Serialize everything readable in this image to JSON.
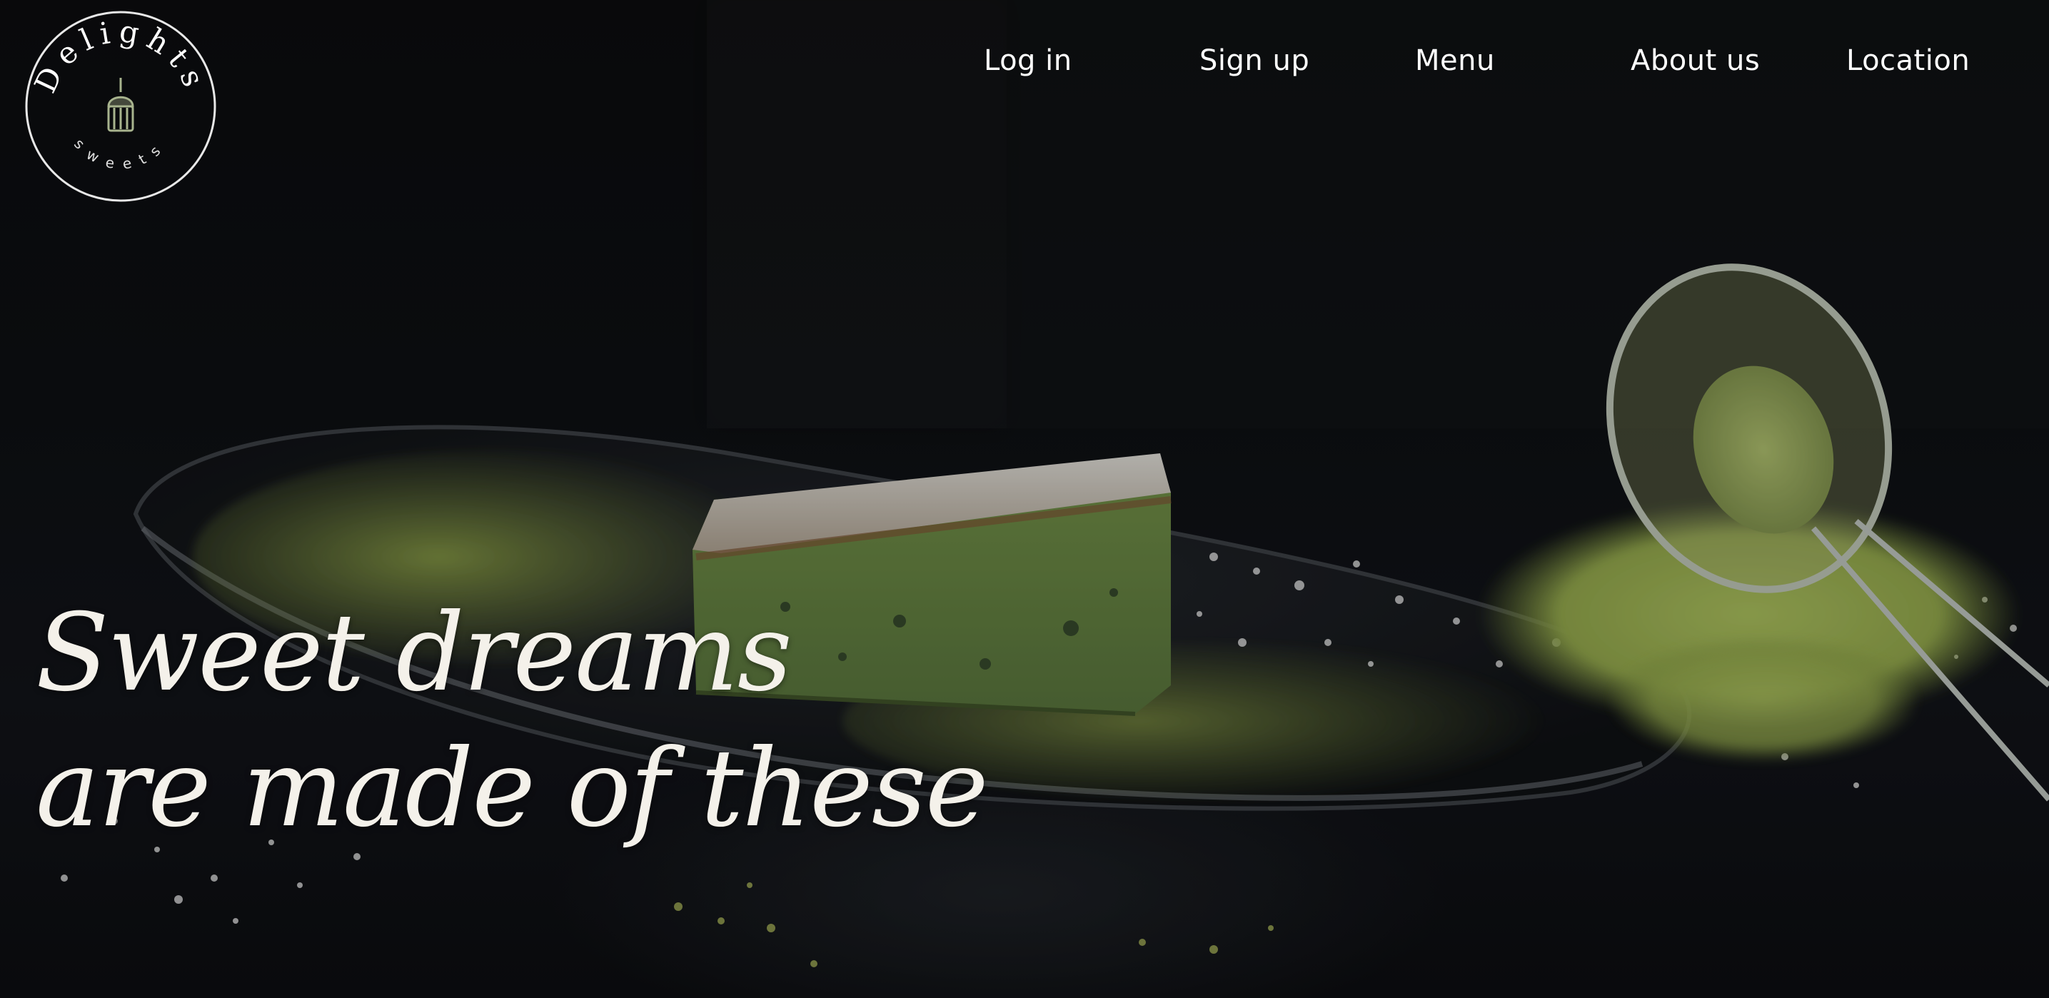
{
  "logo": {
    "name": "Delights",
    "subtitle": "sweets"
  },
  "nav": {
    "items": [
      {
        "label": "Log in"
      },
      {
        "label": "Sign up"
      },
      {
        "label": "Menu"
      },
      {
        "label": "About us"
      },
      {
        "label": "Location"
      }
    ]
  },
  "hero": {
    "tagline_line1": "Sweet dreams",
    "tagline_line2": "are made of these"
  },
  "colors": {
    "background": "#0a0b0d",
    "matcha_green": "#7b9a3c",
    "cake_green": "#5f7f3a",
    "text": "#ffffff"
  }
}
